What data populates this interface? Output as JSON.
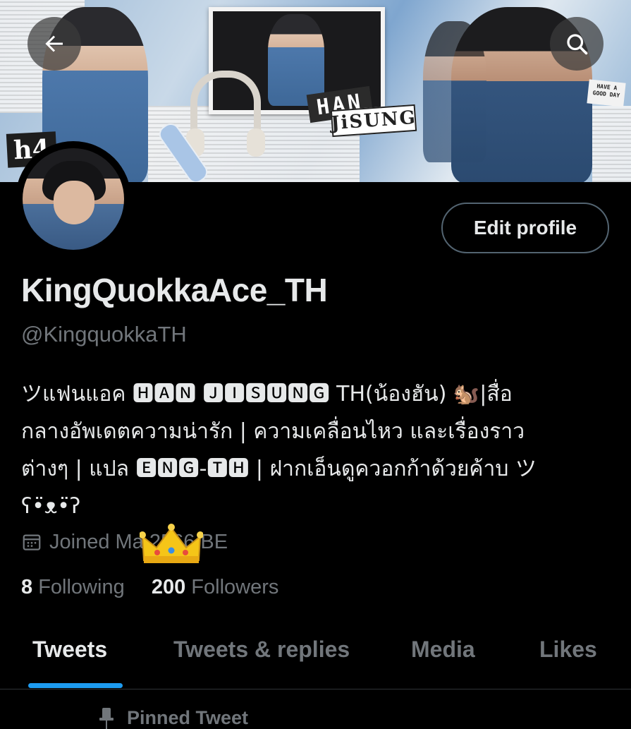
{
  "header": {
    "back_icon": "arrow-left-icon",
    "search_icon": "search-icon",
    "banner_labels": {
      "han": "HAN",
      "jisung": "JiSUNG",
      "note": "HAVE A GOOD DAY",
      "tag": "h4"
    }
  },
  "profile": {
    "edit_button": "Edit profile",
    "display_name": "KingQuokkaAce_TH",
    "handle": "@KingquokkaTH",
    "bio_lines": [
      "ツแฟนแอค 🅷🅰🅽 🅹🅸🆂🆄🅽🅶 TH(น้องฮัน) 🐿️|สื่อ",
      "กลางอัพเดตความน่ารัก | ความเคลื่อนไหว และเรื่องราว",
      "ต่างๆ | แปล 🅴🅽🅶-🆃🅷 | ฝากเอ็นดูควอกก้าด้วยค้าบ ツ",
      "ʕ•̈ᴥ•̈ʔ"
    ],
    "joined_icon": "calendar-icon",
    "joined_text": "Joined Ma   2566 BE",
    "crown_icon": "crown-icon",
    "following_count": "8",
    "following_label": "Following",
    "followers_count": "200",
    "followers_label": "Followers"
  },
  "tabs": [
    {
      "label": "Tweets",
      "active": true
    },
    {
      "label": "Tweets & replies",
      "active": false
    },
    {
      "label": "Media",
      "active": false
    },
    {
      "label": "Likes",
      "active": false
    }
  ],
  "pinned": {
    "icon": "pin-icon",
    "label": "Pinned Tweet"
  },
  "colors": {
    "background": "#000000",
    "primary_text": "#e7e9ea",
    "secondary_text": "#71767b",
    "accent": "#1d9bf0",
    "border": "#536471"
  }
}
